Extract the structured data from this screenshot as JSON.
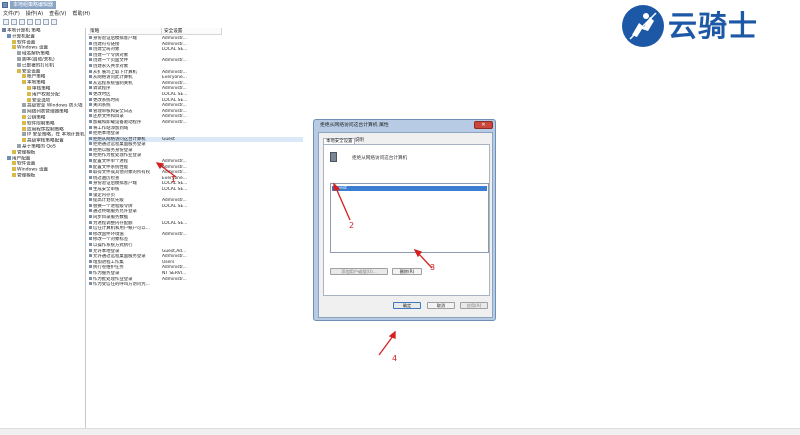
{
  "window": {
    "title": "本地组策略编辑器"
  },
  "menu": [
    "文件(F)",
    "操作(A)",
    "查看(V)",
    "帮助(H)"
  ],
  "tree": [
    {
      "label": "本地计算机 策略",
      "indent": 0,
      "color": "#6f7fa0"
    },
    {
      "label": "计算机配置",
      "indent": 1,
      "color": "#6f8fb8"
    },
    {
      "label": "软件设置",
      "indent": 2,
      "color": "#d9b94a"
    },
    {
      "label": "Windows 设置",
      "indent": 2,
      "color": "#d9b94a"
    },
    {
      "label": "域名解析策略",
      "indent": 3,
      "color": "#9aa3ad"
    },
    {
      "label": "脚本(启动/关机)",
      "indent": 3,
      "color": "#9aa3ad"
    },
    {
      "label": "已部署的打印机",
      "indent": 3,
      "color": "#9aa3ad"
    },
    {
      "label": "安全设置",
      "indent": 3,
      "color": "#d9b94a"
    },
    {
      "label": "帐户策略",
      "indent": 4,
      "color": "#d9b94a"
    },
    {
      "label": "本地策略",
      "indent": 4,
      "color": "#d9b94a"
    },
    {
      "label": "审核策略",
      "indent": 5,
      "color": "#d9b94a"
    },
    {
      "label": "用户权限分配",
      "indent": 5,
      "color": "#d9b94a"
    },
    {
      "label": "安全选项",
      "indent": 5,
      "color": "#d9b94a"
    },
    {
      "label": "高级安全 Windows 防火墙",
      "indent": 4,
      "color": "#9aa3ad"
    },
    {
      "label": "网络列表管理器策略",
      "indent": 4,
      "color": "#9aa3ad"
    },
    {
      "label": "公钥策略",
      "indent": 4,
      "color": "#d9b94a"
    },
    {
      "label": "软件限制策略",
      "indent": 4,
      "color": "#d9b94a"
    },
    {
      "label": "应用程序控制策略",
      "indent": 4,
      "color": "#d9b94a"
    },
    {
      "label": "IP 安全策略，在 本地计算机",
      "indent": 4,
      "color": "#9aa3ad"
    },
    {
      "label": "高级审核策略配置",
      "indent": 4,
      "color": "#d9b94a"
    },
    {
      "label": "基于策略的 QoS",
      "indent": 3,
      "color": "#9aa3ad"
    },
    {
      "label": "管理模板",
      "indent": 2,
      "color": "#d9b94a"
    },
    {
      "label": "用户配置",
      "indent": 1,
      "color": "#6f8fb8"
    },
    {
      "label": "软件设置",
      "indent": 2,
      "color": "#d9b94a"
    },
    {
      "label": "Windows 设置",
      "indent": 2,
      "color": "#d9b94a"
    },
    {
      "label": "管理模板",
      "indent": 2,
      "color": "#d9b94a"
    }
  ],
  "columns": {
    "policy": "策略",
    "setting": "安全设置"
  },
  "policies": [
    [
      "身份验证后模拟客户端",
      "Administr..."
    ],
    [
      "创建符号链接",
      "Administr..."
    ],
    [
      "创建全局对象",
      "LOCAL SE..."
    ],
    [
      "创建一个令牌对象",
      ""
    ],
    [
      "创建一个页面文件",
      "Administr..."
    ],
    [
      "创建永久共享对象",
      ""
    ],
    [
      "从扩展坞上取下计算机",
      "Administr..."
    ],
    [
      "从网络访问此计算机",
      "Everyone..."
    ],
    [
      "从远程系统强制关机",
      "Administr..."
    ],
    [
      "调试程序",
      "Administr..."
    ],
    [
      "更改时区",
      "LOCAL SE..."
    ],
    [
      "更改系统时间",
      "LOCAL SE..."
    ],
    [
      "关闭系统",
      "Administr..."
    ],
    [
      "管理审核和安全日志",
      "Administr..."
    ],
    [
      "还原文件和目录",
      "Administr..."
    ],
    [
      "加载和卸载设备驱动程序",
      "Administr..."
    ],
    [
      "将工作站添加到域",
      ""
    ],
    [
      "拒绝本地登录",
      ""
    ],
    [
      "拒绝从网络访问这台计算机",
      "Guest"
    ],
    [
      "拒绝通过远程桌面服务登录",
      ""
    ],
    [
      "拒绝以服务身份登录",
      ""
    ],
    [
      "拒绝作为批处理作业登录",
      ""
    ],
    [
      "配置文件单个进程",
      "Administr..."
    ],
    [
      "配置文件系统性能",
      "Administr..."
    ],
    [
      "取得文件或其他对象的所有权",
      "Administr..."
    ],
    [
      "绕过遍历检查",
      "Everyone..."
    ],
    [
      "身份验证后模拟客户端",
      "LOCAL SE..."
    ],
    [
      "生成安全审核",
      "LOCAL SE..."
    ],
    [
      "锁定内存页",
      ""
    ],
    [
      "提高计划优先级",
      "Administr..."
    ],
    [
      "替换一个进程级令牌",
      "LOCAL SE..."
    ],
    [
      "通过终端服务允许登录",
      ""
    ],
    [
      "同步目录服务数据",
      ""
    ],
    [
      "为进程调整内存配额",
      "LOCAL SE..."
    ],
    [
      "信任计算机和用户帐户可以...",
      ""
    ],
    [
      "修改固件环境值",
      "Administr..."
    ],
    [
      "修改一个对象标签",
      ""
    ],
    [
      "以操作系统方式执行",
      ""
    ],
    [
      "允许本地登录",
      "Guest,Ad..."
    ],
    [
      "允许通过远程桌面服务登录",
      "Administr..."
    ],
    [
      "增加进程工作集",
      "Users"
    ],
    [
      "执行卷维护任务",
      "Administr..."
    ],
    [
      "作为服务登录",
      "NT SERVI..."
    ],
    [
      "作为批处理作业登录",
      "Administr..."
    ],
    [
      "作为受信任的呼叫方访问凭...",
      ""
    ]
  ],
  "dialog": {
    "title": "拒绝从网络访问这台计算机 属性",
    "close": "✕",
    "tab_local": "本地安全设置",
    "tab_explain": "说明",
    "policy_name": "拒绝从网络访问这台计算机",
    "member": "Guest",
    "add_button": "添加用户或组(U)...",
    "remove_button": "删除(R)",
    "ok_button": "确定",
    "cancel_button": "取消",
    "apply_button": "应用(A)"
  },
  "annotations": [
    "1",
    "2",
    "3",
    "4"
  ],
  "watermark": {
    "text": "云骑士",
    "color": "#1d58a6"
  }
}
